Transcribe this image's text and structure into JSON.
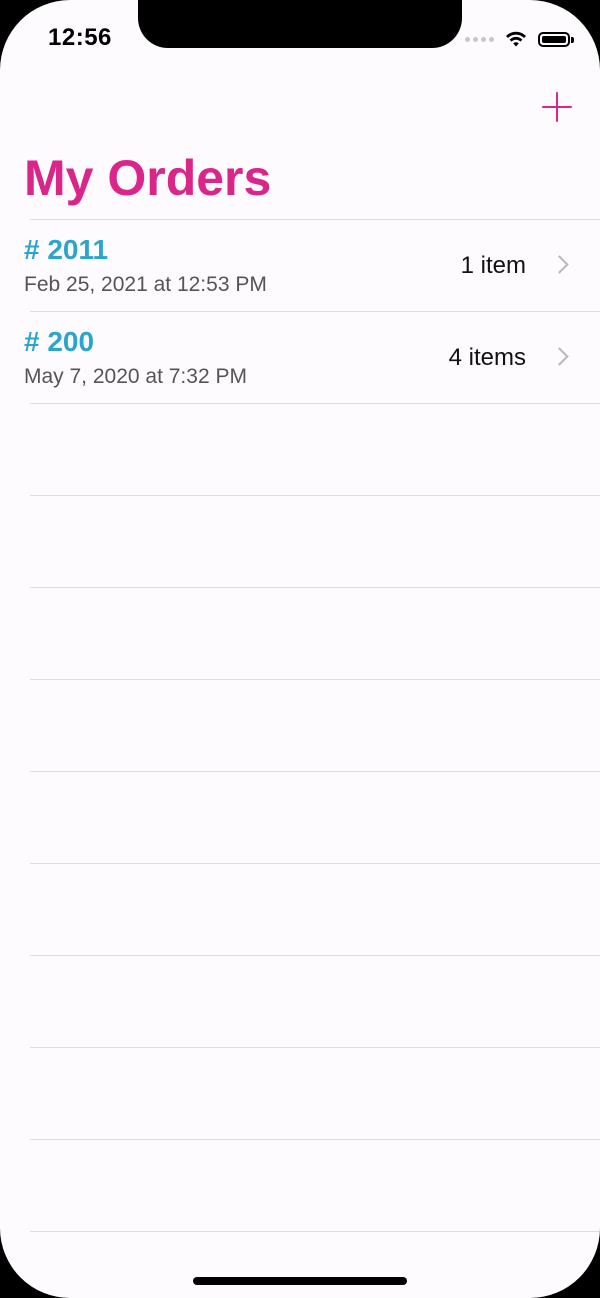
{
  "status_bar": {
    "time": "12:56",
    "signal_icon": "cellular-dots-icon",
    "wifi_icon": "wifi-icon",
    "battery_icon": "battery-icon",
    "battery_level": 1.0
  },
  "nav": {
    "add_icon": "plus-icon",
    "title": "My Orders"
  },
  "orders": [
    {
      "number": "# 2011",
      "date": "Feb 25, 2021 at 12:53 PM",
      "count": "1 item"
    },
    {
      "number": "# 200",
      "date": "May 7, 2020 at 7:32 PM",
      "count": "4 items"
    }
  ],
  "colors": {
    "accent": "#d9268a",
    "order_number": "#2aa6cc",
    "background": "#fdfbfd"
  }
}
